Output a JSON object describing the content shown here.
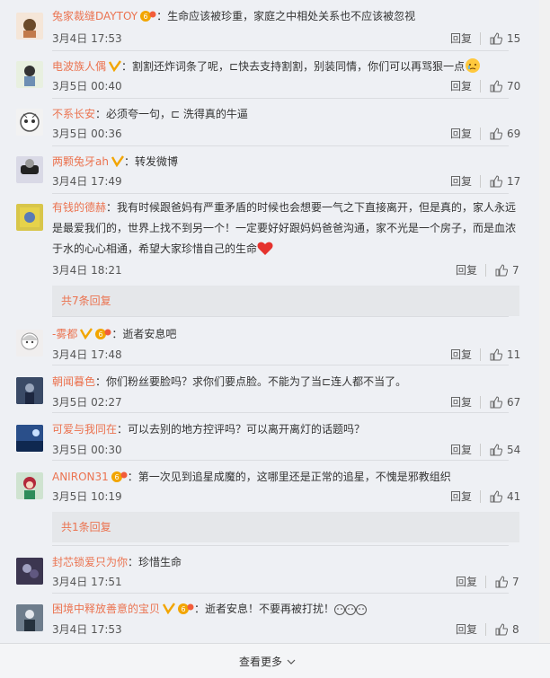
{
  "comments": [
    {
      "user": "兔家裁缝DAYTOY",
      "badge": false,
      "vip": true,
      "text": "生命应该被珍重，家庭之中相处关系也不应该被忽视",
      "date": "3月4日 17:53",
      "reply": "回复",
      "likes": "15",
      "avatar_color": "#f5e6d8"
    },
    {
      "user": "电波族人偶",
      "badge": true,
      "vip": false,
      "text": "割割还炸词条了呢，⊏快去支持割割，别装同情，你们可以再骂狠一点",
      "date": "3月5日 00:40",
      "reply": "回复",
      "likes": "70",
      "avatar_color": "#e8f0e0"
    },
    {
      "user": "不系长安",
      "badge": false,
      "vip": false,
      "text": "必须夸一句，⊏ 洗得真的牛逼",
      "date": "3月5日 00:36",
      "reply": "回复",
      "likes": "69",
      "avatar_color": "#f2f2f2"
    },
    {
      "user": "两颗兔牙ah",
      "badge": true,
      "vip": false,
      "text": "转发微博",
      "date": "3月4日 17:49",
      "reply": "回复",
      "likes": "17",
      "avatar_color": "#d9d9e6"
    },
    {
      "user": "有钱的德赫",
      "badge": false,
      "vip": false,
      "text": "我有时候跟爸妈有严重矛盾的时候也会想要一气之下直接离开，但是真的，家人永远是最爱我们的，世界上找不到另一个！一定要好好跟妈妈爸爸沟通，家不光是一个房子，而是血浓于水的心心相通，希望大家珍惜自己的生命",
      "date": "3月4日 18:21",
      "reply": "回复",
      "likes": "7",
      "avatar_color": "#d8c64a"
    },
    {
      "user": "-雾都",
      "badge": true,
      "vip": true,
      "text": "逝者安息吧",
      "date": "3月4日 17:48",
      "reply": "回复",
      "likes": "11",
      "avatar_color": "#f0eeee"
    },
    {
      "user": "朝闻暮色",
      "badge": false,
      "vip": false,
      "text": "你们粉丝要脸吗？求你们要点脸。不能为了当⊏连人都不当了。",
      "date": "3月5日 02:27",
      "reply": "回复",
      "likes": "67",
      "avatar_color": "#3a4a66"
    },
    {
      "user": "可爱与我同在",
      "badge": false,
      "vip": false,
      "text": "可以去别的地方控评吗？可以离开离灯的话题吗？",
      "date": "3月5日 00:30",
      "reply": "回复",
      "likes": "54",
      "avatar_color": "#2a4f8a"
    },
    {
      "user": "ANIRON31",
      "badge": false,
      "vip": true,
      "text": "第一次见到追星成魔的，这哪里还是正常的追星，不愧是邪教组织",
      "date": "3月5日 10:19",
      "reply": "回复",
      "likes": "41",
      "avatar_color": "#cfe3d0"
    },
    {
      "user": "封芯锁爱只为你",
      "badge": false,
      "vip": false,
      "text": "珍惜生命",
      "date": "3月4日 17:51",
      "reply": "回复",
      "likes": "7",
      "avatar_color": "#3c3650"
    },
    {
      "user": "困境中释放善意的宝贝",
      "badge": true,
      "vip": true,
      "text": "逝者安息！不要再被打扰！",
      "date": "3月4日 17:53",
      "reply": "回复",
      "likes": "8",
      "avatar_color": "#6e7d8c"
    }
  ],
  "more_replies": [
    "共7条回复",
    "共1条回复"
  ],
  "footer": {
    "view_more": "查看更多"
  },
  "colors": {
    "username": "#eb7350",
    "background": "#eef0f4",
    "badge": "#f2a500"
  }
}
